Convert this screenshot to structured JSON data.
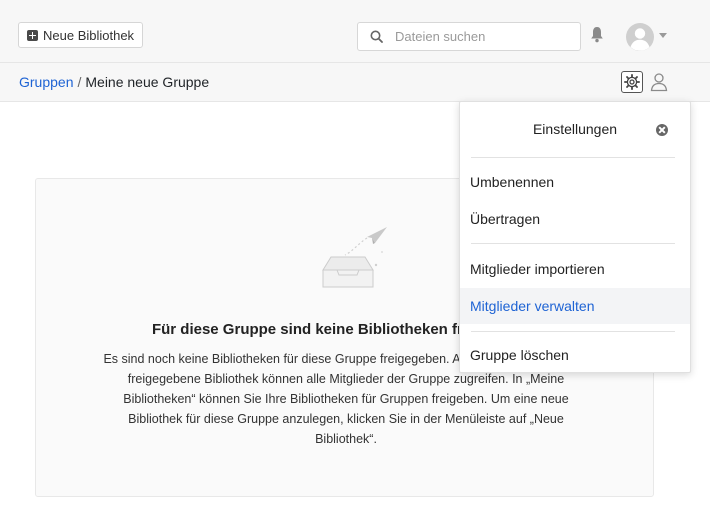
{
  "toolbar": {
    "new_library_label": "Neue Bibliothek",
    "search_placeholder": "Dateien suchen"
  },
  "breadcrumb": {
    "parent": "Gruppen",
    "separator": "/",
    "current": "Meine neue Gruppe"
  },
  "empty_state": {
    "title": "Für diese Gruppe sind keine Bibliotheken freigegeben",
    "description": "Es sind noch keine Bibliotheken für diese Gruppe freigegeben. Auf eine für eine Gruppe freigegebene Bibliothek können alle Mitglieder der Gruppe zugreifen. In „Meine Bibliotheken“ können Sie Ihre Bibliotheken für Gruppen freigeben. Um eine neue Bibliothek für diese Gruppe anzulegen, klicken Sie in der Menüleiste auf „Neue Bibliothek“."
  },
  "settings_menu": {
    "title": "Einstellungen",
    "items": [
      {
        "label": "Umbenennen"
      },
      {
        "label": "Übertragen"
      },
      {
        "label": "Mitglieder importieren"
      },
      {
        "label": "Mitglieder verwalten",
        "active": true
      },
      {
        "label": "Gruppe löschen"
      }
    ]
  },
  "colors": {
    "link": "#1e63d4",
    "topbar_bg": "#f7f7f7",
    "active_item_bg": "#f3f4f6"
  }
}
